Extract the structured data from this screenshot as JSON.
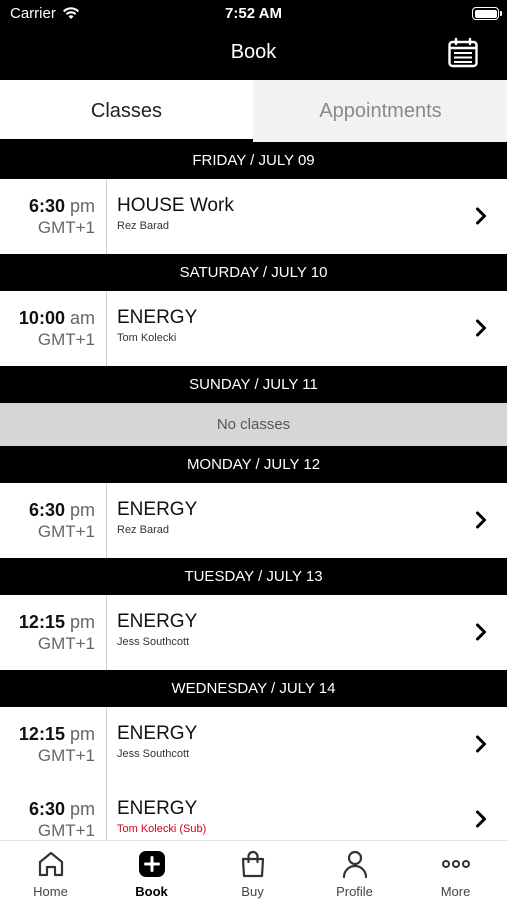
{
  "status_bar": {
    "carrier": "Carrier",
    "time": "7:52 AM"
  },
  "nav": {
    "title": "Book",
    "calendar_icon": "calendar-icon"
  },
  "tabs": [
    {
      "label": "Classes",
      "active": true
    },
    {
      "label": "Appointments",
      "active": false
    }
  ],
  "days": [
    {
      "header": "FRIDAY / JULY 09",
      "classes": [
        {
          "time": "6:30",
          "ampm": "pm",
          "tz": "GMT+1",
          "name": "HOUSE Work",
          "instructor": "Rez Barad"
        }
      ]
    },
    {
      "header": "SATURDAY / JULY 10",
      "classes": [
        {
          "time": "10:00",
          "ampm": "am",
          "tz": "GMT+1",
          "name": "ENERGY",
          "instructor": "Tom Kolecki"
        }
      ]
    },
    {
      "header": "SUNDAY / JULY 11",
      "empty_text": "No classes",
      "classes": []
    },
    {
      "header": "MONDAY / JULY 12",
      "classes": [
        {
          "time": "6:30",
          "ampm": "pm",
          "tz": "GMT+1",
          "name": "ENERGY",
          "instructor": "Rez Barad"
        }
      ]
    },
    {
      "header": "TUESDAY / JULY 13",
      "classes": [
        {
          "time": "12:15",
          "ampm": "pm",
          "tz": "GMT+1",
          "name": "ENERGY",
          "instructor": "Jess Southcott"
        }
      ]
    },
    {
      "header": "WEDNESDAY / JULY 14",
      "classes": [
        {
          "time": "12:15",
          "ampm": "pm",
          "tz": "GMT+1",
          "name": "ENERGY",
          "instructor": "Jess Southcott"
        },
        {
          "time": "6:30",
          "ampm": "pm",
          "tz": "GMT+1",
          "name": "ENERGY",
          "instructor": "Tom Kolecki (Sub)",
          "substitute": true
        }
      ]
    }
  ],
  "tab_bar": [
    {
      "label": "Home",
      "icon": "home-icon",
      "active": false
    },
    {
      "label": "Book",
      "icon": "plus-square-icon",
      "active": true
    },
    {
      "label": "Buy",
      "icon": "shopping-bag-icon",
      "active": false
    },
    {
      "label": "Profile",
      "icon": "person-icon",
      "active": false
    },
    {
      "label": "More",
      "icon": "more-dots-icon",
      "active": false
    }
  ],
  "colors": {
    "header_bg": "#000000",
    "no_classes_bg": "#d6d6d6",
    "substitute": "#d0021b",
    "inactive_tab_text": "#8a8a8a"
  }
}
